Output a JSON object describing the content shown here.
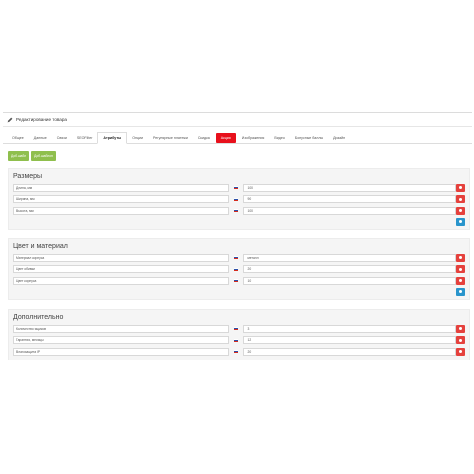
{
  "header": {
    "title": "Редактирование товара"
  },
  "tabs": [
    {
      "label": "Общее",
      "state": "normal"
    },
    {
      "label": "Данные",
      "state": "normal"
    },
    {
      "label": "Связи",
      "state": "normal"
    },
    {
      "label": "SEOFilter",
      "state": "normal"
    },
    {
      "label": "Атрибуты",
      "state": "active"
    },
    {
      "label": "Опции",
      "state": "normal"
    },
    {
      "label": "Регулярные платежи",
      "state": "normal"
    },
    {
      "label": "Скидка",
      "state": "normal"
    },
    {
      "label": "Акция",
      "state": "highlight"
    },
    {
      "label": "Изображения",
      "state": "normal"
    },
    {
      "label": "Видео",
      "state": "normal"
    },
    {
      "label": "Бонусные баллы",
      "state": "normal"
    },
    {
      "label": "Дизайн",
      "state": "normal"
    }
  ],
  "toolbar": {
    "add_attribute": "Доб.шабл",
    "add_template": "Доб.шаблон"
  },
  "sections": [
    {
      "title": "Размеры",
      "rows": [
        {
          "name": "Длина, мм",
          "value": "100"
        },
        {
          "name": "Ширина, мм",
          "value": "90"
        },
        {
          "name": "Высота, мм",
          "value": "100"
        }
      ]
    },
    {
      "title": "Цвет и материал",
      "rows": [
        {
          "name": "Материал корпуса",
          "value": "металл"
        },
        {
          "name": "Цвет обивки",
          "value": "20"
        },
        {
          "name": "Цвет корпуса",
          "value": "10"
        }
      ]
    },
    {
      "title": "Дополнительно",
      "rows": [
        {
          "name": "Количество ящиков",
          "value": "3"
        },
        {
          "name": "Гарантия, месяцы",
          "value": "12"
        },
        {
          "name": "Влагозащита IP",
          "value": "20"
        }
      ]
    }
  ],
  "colors": {
    "accent_red": "#e8101c",
    "delete": "#e5413d",
    "add": "#2a95cc",
    "success": "#8fbf4d"
  },
  "icons": {
    "header": "pencil-icon",
    "language": "flag-ru-icon",
    "delete": "minus-circle-icon",
    "add": "plus-circle-icon"
  }
}
